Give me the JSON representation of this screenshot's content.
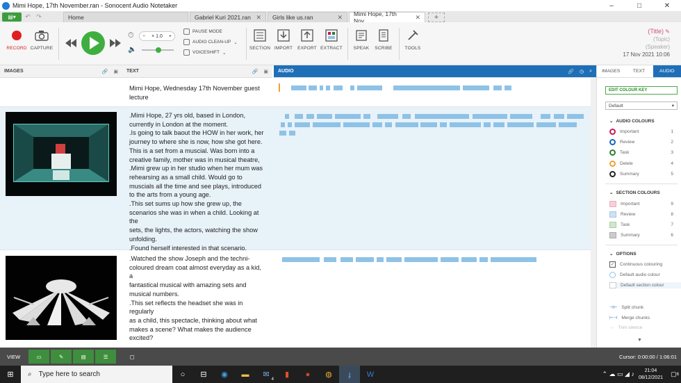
{
  "window": {
    "title": "Mimi Hope, 17th November.ran - Sonocent Audio Notetaker",
    "controls": [
      "–",
      "□",
      "✕"
    ]
  },
  "tabs": [
    {
      "label": "Home"
    },
    {
      "label": "Gabriel Kuri 2021.ran"
    },
    {
      "label": "Girls like us.ran"
    },
    {
      "label": "Mimi Hope, 17th Nov..."
    }
  ],
  "tab_close": "✕",
  "new_tab": "+",
  "ribbon": {
    "record": "RECORD",
    "capture": "CAPTURE",
    "speed": "× 1.0",
    "speed_minus": "−",
    "speed_plus": "+",
    "pause_mode": "PAUSE MODE",
    "audio_cleanup": "AUDIO CLEAN-UP",
    "voiceshift": "VOICESHIFT",
    "section": "SECTION",
    "import": "IMPORT",
    "export": "EXPORT",
    "extract": "EXTRACT",
    "speak": "SPEAK",
    "scribe": "SCRIBE",
    "tools": "TOOLS",
    "meta_title": "(Title)",
    "meta_topic": "(Topic)",
    "meta_speaker": "(Speaker)",
    "meta_date": "17 Nov 2021 10:06"
  },
  "columns": {
    "images": "IMAGES",
    "text": "TEXT",
    "audio": "AUDIO"
  },
  "sections": [
    {
      "text": [
        "Mimi Hope, Wednesday 17th November guest",
        "lecture"
      ]
    },
    {
      "text": [
        ".Mimi Hope, 27 yrs old, based in London,",
        "currently in London at the moment.",
        ".Is going to talk baout the HOW in her work, her",
        "journey to where she is now, how she got here.",
        "This is a set from a muscial. Was born into a",
        "creative family, mother was in musical theatre,",
        ".Mimi grew up in her studio when her mum was",
        "rehearsing as a small child. Would go to",
        "muscials all the time and see plays, introduced",
        "to the arts from a young age.",
        ".This set sums up how she grew up, the",
        "scenarios she was in when a child. Looking at the",
        "sets, the lights, the actors, watching the show",
        "unfolding.",
        ".Found herself interested in that scenario."
      ]
    },
    {
      "text": [
        ".Watched the show Joseph and the techni-",
        "coloured dream coat almost everyday as a kid, a",
        "fantastical musical with amazing sets and",
        "musical numbers.",
        ".This set reflects the headset she was in regularly",
        "as a child, this spectacle, thinking about what",
        "makes a scene? What makes the audience",
        "excited?"
      ]
    }
  ],
  "sidebar": {
    "tabs": [
      "IMAGES",
      "TEXT",
      "AUDIO"
    ],
    "edit_colour_key": "EDIT COLOUR KEY",
    "preset": "Default",
    "audio_colours_title": "AUDIO COLOURS",
    "audio_colours": [
      {
        "label": "Important",
        "count": "1",
        "color": "#c2185b"
      },
      {
        "label": "Review",
        "count": "2",
        "color": "#1565c0"
      },
      {
        "label": "Task",
        "count": "3",
        "color": "#2e7d32"
      },
      {
        "label": "Delete",
        "count": "4",
        "color": "#f0a030"
      },
      {
        "label": "Summary",
        "count": "5",
        "color": "#222222"
      }
    ],
    "section_colours_title": "SECTION COLOURS",
    "section_colours": [
      {
        "label": "Important",
        "count": "9",
        "color": "#f6d0da"
      },
      {
        "label": "Review",
        "count": "8",
        "color": "#cfe0f6"
      },
      {
        "label": "Task",
        "count": "7",
        "color": "#cfe8cc"
      },
      {
        "label": "Summary",
        "count": "6",
        "color": "#cccccc"
      }
    ],
    "options_title": "OPTIONS",
    "options": [
      "Continuous colouring",
      "Default audio colour",
      "Default section colour"
    ],
    "actions": [
      "Split chunk",
      "Merge chunks",
      "Trim silence"
    ]
  },
  "statusbar": {
    "view": "VIEW",
    "cursor": "Cursor: 0:00:00 / 1:06:01"
  },
  "taskbar": {
    "search": "Type here to search",
    "time": "21:04",
    "date": "08/12/2021",
    "notif": "6",
    "mail_badge": "4"
  }
}
